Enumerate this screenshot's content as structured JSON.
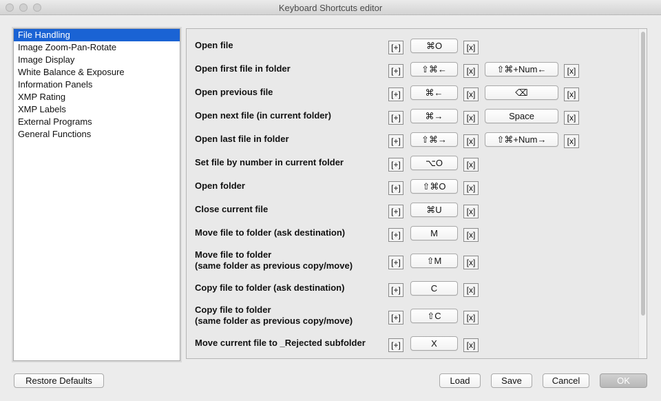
{
  "window": {
    "title": "Keyboard Shortcuts editor"
  },
  "sidebar": {
    "items": [
      {
        "label": "File Handling",
        "selected": true
      },
      {
        "label": "Image Zoom-Pan-Rotate"
      },
      {
        "label": "Image Display"
      },
      {
        "label": "White Balance & Exposure"
      },
      {
        "label": "Information Panels"
      },
      {
        "label": "XMP Rating"
      },
      {
        "label": "XMP Labels"
      },
      {
        "label": "External Programs"
      },
      {
        "label": "General Functions"
      }
    ]
  },
  "shortcuts": {
    "add_label": "[+]",
    "remove_label": "[x]",
    "rows": [
      {
        "line1": "Open file",
        "key1": "⌘O"
      },
      {
        "line1": "Open first file in folder",
        "key1": "⇧⌘←",
        "key2": "⇧⌘+Num←"
      },
      {
        "line1": "Open previous file",
        "key1": "⌘←",
        "key2": "⌫"
      },
      {
        "line1": "Open next file (in current folder)",
        "key1": "⌘→",
        "key2": "Space"
      },
      {
        "line1": "Open last file in folder",
        "key1": "⇧⌘→",
        "key2": "⇧⌘+Num→"
      },
      {
        "line1": "Set file by number in current folder",
        "key1": "⌥O"
      },
      {
        "line1": "Open folder",
        "key1": "⇧⌘O"
      },
      {
        "line1": "Close current file",
        "key1": "⌘U"
      },
      {
        "line1": "Move file to folder (ask destination)",
        "key1": "M"
      },
      {
        "line1": "Move file to folder",
        "line2": "(same folder as previous copy/move)",
        "key1": "⇧M"
      },
      {
        "line1": "Copy file to folder (ask destination)",
        "key1": "C"
      },
      {
        "line1": "Copy file to folder",
        "line2": "(same folder as previous copy/move)",
        "key1": "⇧C"
      },
      {
        "line1": "Move current file to _Rejected subfolder",
        "key1": "X"
      }
    ]
  },
  "footer": {
    "restore_defaults": "Restore Defaults",
    "load": "Load",
    "save": "Save",
    "cancel": "Cancel",
    "ok": "OK"
  },
  "colors": {
    "selection": "#1a63d4"
  }
}
